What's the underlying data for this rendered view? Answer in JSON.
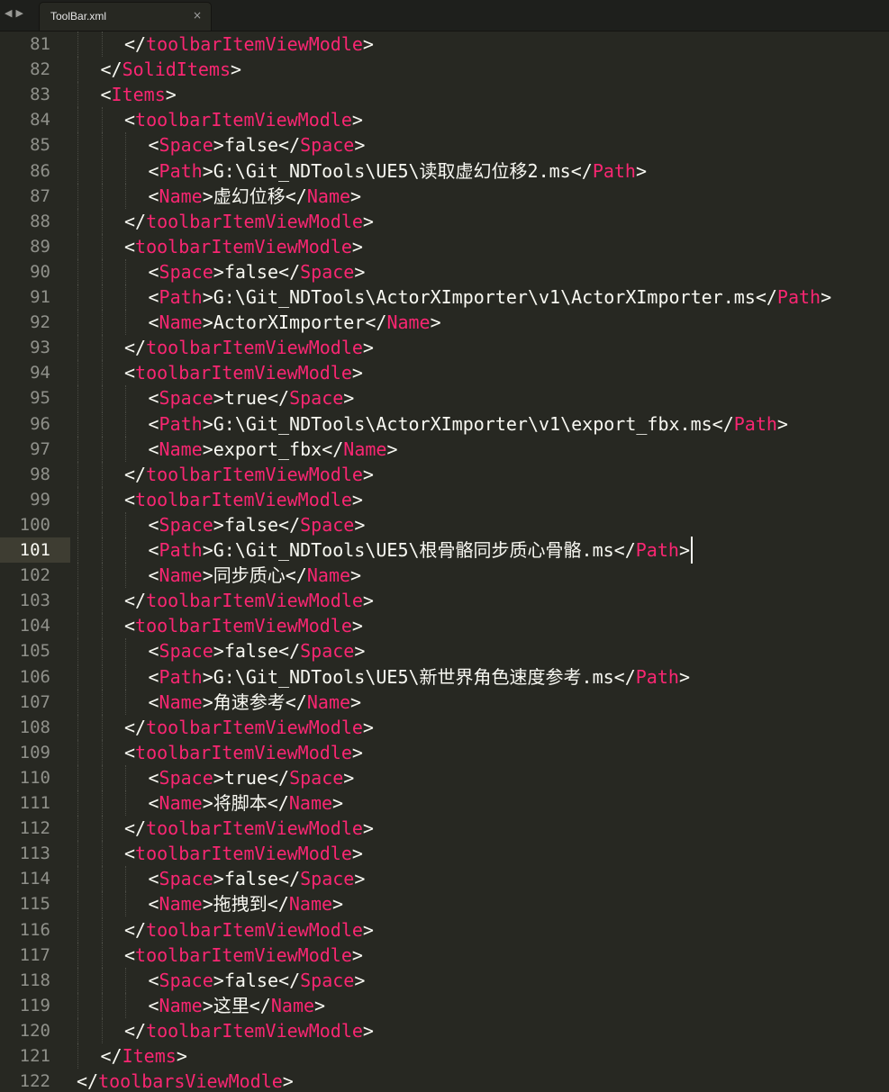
{
  "tab": {
    "title": "ToolBar.xml",
    "close_glyph": "×",
    "nav_back_glyph": "◀",
    "nav_forward_glyph": "▶"
  },
  "editor": {
    "current_line": 101,
    "lines": [
      {
        "n": "81",
        "indent": 2,
        "parts": [
          [
            "p",
            "</"
          ],
          [
            "t",
            "toolbarItemViewModle"
          ],
          [
            "p",
            ">"
          ]
        ]
      },
      {
        "n": "82",
        "indent": 1,
        "parts": [
          [
            "p",
            "</"
          ],
          [
            "t",
            "SolidItems"
          ],
          [
            "p",
            ">"
          ]
        ]
      },
      {
        "n": "83",
        "indent": 1,
        "parts": [
          [
            "p",
            "<"
          ],
          [
            "t",
            "Items"
          ],
          [
            "p",
            ">"
          ]
        ]
      },
      {
        "n": "84",
        "indent": 2,
        "parts": [
          [
            "p",
            "<"
          ],
          [
            "t",
            "toolbarItemViewModle"
          ],
          [
            "p",
            ">"
          ]
        ]
      },
      {
        "n": "85",
        "indent": 3,
        "parts": [
          [
            "p",
            "<"
          ],
          [
            "t",
            "Space"
          ],
          [
            "p",
            ">"
          ],
          [
            "x",
            "false"
          ],
          [
            "p",
            "</"
          ],
          [
            "t",
            "Space"
          ],
          [
            "p",
            ">"
          ]
        ]
      },
      {
        "n": "86",
        "indent": 3,
        "parts": [
          [
            "p",
            "<"
          ],
          [
            "t",
            "Path"
          ],
          [
            "p",
            ">"
          ],
          [
            "x",
            "G:\\Git_NDTools\\UE5\\读取虚幻位移2.ms"
          ],
          [
            "p",
            "</"
          ],
          [
            "t",
            "Path"
          ],
          [
            "p",
            ">"
          ]
        ]
      },
      {
        "n": "87",
        "indent": 3,
        "parts": [
          [
            "p",
            "<"
          ],
          [
            "t",
            "Name"
          ],
          [
            "p",
            ">"
          ],
          [
            "x",
            "虚幻位移"
          ],
          [
            "p",
            "</"
          ],
          [
            "t",
            "Name"
          ],
          [
            "p",
            ">"
          ]
        ]
      },
      {
        "n": "88",
        "indent": 2,
        "parts": [
          [
            "p",
            "</"
          ],
          [
            "t",
            "toolbarItemViewModle"
          ],
          [
            "p",
            ">"
          ]
        ]
      },
      {
        "n": "89",
        "indent": 2,
        "parts": [
          [
            "p",
            "<"
          ],
          [
            "t",
            "toolbarItemViewModle"
          ],
          [
            "p",
            ">"
          ]
        ]
      },
      {
        "n": "90",
        "indent": 3,
        "parts": [
          [
            "p",
            "<"
          ],
          [
            "t",
            "Space"
          ],
          [
            "p",
            ">"
          ],
          [
            "x",
            "false"
          ],
          [
            "p",
            "</"
          ],
          [
            "t",
            "Space"
          ],
          [
            "p",
            ">"
          ]
        ]
      },
      {
        "n": "91",
        "indent": 3,
        "parts": [
          [
            "p",
            "<"
          ],
          [
            "t",
            "Path"
          ],
          [
            "p",
            ">"
          ],
          [
            "x",
            "G:\\Git_NDTools\\ActorXImporter\\v1\\ActorXImporter.ms"
          ],
          [
            "p",
            "</"
          ],
          [
            "t",
            "Path"
          ],
          [
            "p",
            ">"
          ]
        ]
      },
      {
        "n": "92",
        "indent": 3,
        "parts": [
          [
            "p",
            "<"
          ],
          [
            "t",
            "Name"
          ],
          [
            "p",
            ">"
          ],
          [
            "x",
            "ActorXImporter"
          ],
          [
            "p",
            "</"
          ],
          [
            "t",
            "Name"
          ],
          [
            "p",
            ">"
          ]
        ]
      },
      {
        "n": "93",
        "indent": 2,
        "parts": [
          [
            "p",
            "</"
          ],
          [
            "t",
            "toolbarItemViewModle"
          ],
          [
            "p",
            ">"
          ]
        ]
      },
      {
        "n": "94",
        "indent": 2,
        "parts": [
          [
            "p",
            "<"
          ],
          [
            "t",
            "toolbarItemViewModle"
          ],
          [
            "p",
            ">"
          ]
        ]
      },
      {
        "n": "95",
        "indent": 3,
        "parts": [
          [
            "p",
            "<"
          ],
          [
            "t",
            "Space"
          ],
          [
            "p",
            ">"
          ],
          [
            "x",
            "true"
          ],
          [
            "p",
            "</"
          ],
          [
            "t",
            "Space"
          ],
          [
            "p",
            ">"
          ]
        ]
      },
      {
        "n": "96",
        "indent": 3,
        "parts": [
          [
            "p",
            "<"
          ],
          [
            "t",
            "Path"
          ],
          [
            "p",
            ">"
          ],
          [
            "x",
            "G:\\Git_NDTools\\ActorXImporter\\v1\\export_fbx.ms"
          ],
          [
            "p",
            "</"
          ],
          [
            "t",
            "Path"
          ],
          [
            "p",
            ">"
          ]
        ]
      },
      {
        "n": "97",
        "indent": 3,
        "parts": [
          [
            "p",
            "<"
          ],
          [
            "t",
            "Name"
          ],
          [
            "p",
            ">"
          ],
          [
            "x",
            "export_fbx"
          ],
          [
            "p",
            "</"
          ],
          [
            "t",
            "Name"
          ],
          [
            "p",
            ">"
          ]
        ]
      },
      {
        "n": "98",
        "indent": 2,
        "parts": [
          [
            "p",
            "</"
          ],
          [
            "t",
            "toolbarItemViewModle"
          ],
          [
            "p",
            ">"
          ]
        ]
      },
      {
        "n": "99",
        "indent": 2,
        "parts": [
          [
            "p",
            "<"
          ],
          [
            "t",
            "toolbarItemViewModle"
          ],
          [
            "p",
            ">"
          ]
        ]
      },
      {
        "n": "100",
        "indent": 3,
        "parts": [
          [
            "p",
            "<"
          ],
          [
            "t",
            "Space"
          ],
          [
            "p",
            ">"
          ],
          [
            "x",
            "false"
          ],
          [
            "p",
            "</"
          ],
          [
            "t",
            "Space"
          ],
          [
            "p",
            ">"
          ]
        ]
      },
      {
        "n": "101",
        "indent": 3,
        "parts": [
          [
            "p",
            "<"
          ],
          [
            "t",
            "Path"
          ],
          [
            "p",
            ">"
          ],
          [
            "x",
            "G:\\Git_NDTools\\UE5\\根骨骼同步质心骨骼.ms"
          ],
          [
            "p",
            "</"
          ],
          [
            "t",
            "Path"
          ],
          [
            "p",
            ">"
          ]
        ]
      },
      {
        "n": "102",
        "indent": 3,
        "parts": [
          [
            "p",
            "<"
          ],
          [
            "t",
            "Name"
          ],
          [
            "p",
            ">"
          ],
          [
            "x",
            "同步质心"
          ],
          [
            "p",
            "</"
          ],
          [
            "t",
            "Name"
          ],
          [
            "p",
            ">"
          ]
        ]
      },
      {
        "n": "103",
        "indent": 2,
        "parts": [
          [
            "p",
            "</"
          ],
          [
            "t",
            "toolbarItemViewModle"
          ],
          [
            "p",
            ">"
          ]
        ]
      },
      {
        "n": "104",
        "indent": 2,
        "parts": [
          [
            "p",
            "<"
          ],
          [
            "t",
            "toolbarItemViewModle"
          ],
          [
            "p",
            ">"
          ]
        ]
      },
      {
        "n": "105",
        "indent": 3,
        "parts": [
          [
            "p",
            "<"
          ],
          [
            "t",
            "Space"
          ],
          [
            "p",
            ">"
          ],
          [
            "x",
            "false"
          ],
          [
            "p",
            "</"
          ],
          [
            "t",
            "Space"
          ],
          [
            "p",
            ">"
          ]
        ]
      },
      {
        "n": "106",
        "indent": 3,
        "parts": [
          [
            "p",
            "<"
          ],
          [
            "t",
            "Path"
          ],
          [
            "p",
            ">"
          ],
          [
            "x",
            "G:\\Git_NDTools\\UE5\\新世界角色速度参考.ms"
          ],
          [
            "p",
            "</"
          ],
          [
            "t",
            "Path"
          ],
          [
            "p",
            ">"
          ]
        ]
      },
      {
        "n": "107",
        "indent": 3,
        "parts": [
          [
            "p",
            "<"
          ],
          [
            "t",
            "Name"
          ],
          [
            "p",
            ">"
          ],
          [
            "x",
            "角速参考"
          ],
          [
            "p",
            "</"
          ],
          [
            "t",
            "Name"
          ],
          [
            "p",
            ">"
          ]
        ]
      },
      {
        "n": "108",
        "indent": 2,
        "parts": [
          [
            "p",
            "</"
          ],
          [
            "t",
            "toolbarItemViewModle"
          ],
          [
            "p",
            ">"
          ]
        ]
      },
      {
        "n": "109",
        "indent": 2,
        "parts": [
          [
            "p",
            "<"
          ],
          [
            "t",
            "toolbarItemViewModle"
          ],
          [
            "p",
            ">"
          ]
        ]
      },
      {
        "n": "110",
        "indent": 3,
        "parts": [
          [
            "p",
            "<"
          ],
          [
            "t",
            "Space"
          ],
          [
            "p",
            ">"
          ],
          [
            "x",
            "true"
          ],
          [
            "p",
            "</"
          ],
          [
            "t",
            "Space"
          ],
          [
            "p",
            ">"
          ]
        ]
      },
      {
        "n": "111",
        "indent": 3,
        "parts": [
          [
            "p",
            "<"
          ],
          [
            "t",
            "Name"
          ],
          [
            "p",
            ">"
          ],
          [
            "x",
            "将脚本"
          ],
          [
            "p",
            "</"
          ],
          [
            "t",
            "Name"
          ],
          [
            "p",
            ">"
          ]
        ]
      },
      {
        "n": "112",
        "indent": 2,
        "parts": [
          [
            "p",
            "</"
          ],
          [
            "t",
            "toolbarItemViewModle"
          ],
          [
            "p",
            ">"
          ]
        ]
      },
      {
        "n": "113",
        "indent": 2,
        "parts": [
          [
            "p",
            "<"
          ],
          [
            "t",
            "toolbarItemViewModle"
          ],
          [
            "p",
            ">"
          ]
        ]
      },
      {
        "n": "114",
        "indent": 3,
        "parts": [
          [
            "p",
            "<"
          ],
          [
            "t",
            "Space"
          ],
          [
            "p",
            ">"
          ],
          [
            "x",
            "false"
          ],
          [
            "p",
            "</"
          ],
          [
            "t",
            "Space"
          ],
          [
            "p",
            ">"
          ]
        ]
      },
      {
        "n": "115",
        "indent": 3,
        "parts": [
          [
            "p",
            "<"
          ],
          [
            "t",
            "Name"
          ],
          [
            "p",
            ">"
          ],
          [
            "x",
            "拖拽到"
          ],
          [
            "p",
            "</"
          ],
          [
            "t",
            "Name"
          ],
          [
            "p",
            ">"
          ]
        ]
      },
      {
        "n": "116",
        "indent": 2,
        "parts": [
          [
            "p",
            "</"
          ],
          [
            "t",
            "toolbarItemViewModle"
          ],
          [
            "p",
            ">"
          ]
        ]
      },
      {
        "n": "117",
        "indent": 2,
        "parts": [
          [
            "p",
            "<"
          ],
          [
            "t",
            "toolbarItemViewModle"
          ],
          [
            "p",
            ">"
          ]
        ]
      },
      {
        "n": "118",
        "indent": 3,
        "parts": [
          [
            "p",
            "<"
          ],
          [
            "t",
            "Space"
          ],
          [
            "p",
            ">"
          ],
          [
            "x",
            "false"
          ],
          [
            "p",
            "</"
          ],
          [
            "t",
            "Space"
          ],
          [
            "p",
            ">"
          ]
        ]
      },
      {
        "n": "119",
        "indent": 3,
        "parts": [
          [
            "p",
            "<"
          ],
          [
            "t",
            "Name"
          ],
          [
            "p",
            ">"
          ],
          [
            "x",
            "这里"
          ],
          [
            "p",
            "</"
          ],
          [
            "t",
            "Name"
          ],
          [
            "p",
            ">"
          ]
        ]
      },
      {
        "n": "120",
        "indent": 2,
        "parts": [
          [
            "p",
            "</"
          ],
          [
            "t",
            "toolbarItemViewModle"
          ],
          [
            "p",
            ">"
          ]
        ]
      },
      {
        "n": "121",
        "indent": 1,
        "parts": [
          [
            "p",
            "</"
          ],
          [
            "t",
            "Items"
          ],
          [
            "p",
            ">"
          ]
        ]
      },
      {
        "n": "122",
        "indent": 0,
        "parts": [
          [
            "p",
            "</"
          ],
          [
            "t",
            "toolbarsViewModle"
          ],
          [
            "p",
            ">"
          ]
        ]
      }
    ]
  },
  "colors": {
    "background": "#272822",
    "tag": "#f92672",
    "text": "#f8f8f2",
    "line_number": "#8f908a",
    "current_line": "#3e3d32"
  }
}
